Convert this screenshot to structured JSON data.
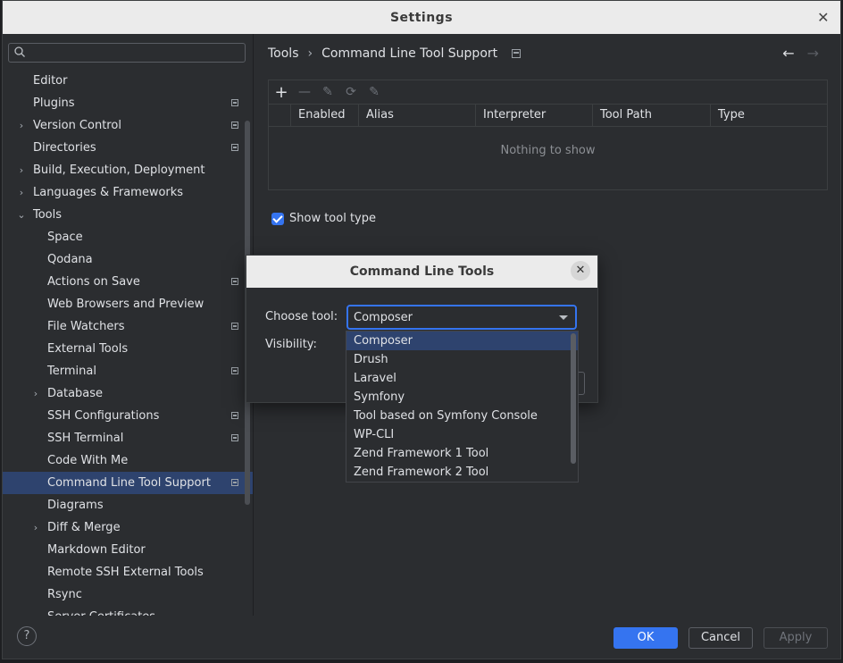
{
  "window": {
    "title": "Settings"
  },
  "sidebar": {
    "search_placeholder": "",
    "items": [
      {
        "label": "Editor",
        "level": 0,
        "expand": "none",
        "proj": false
      },
      {
        "label": "Plugins",
        "level": 0,
        "expand": "none",
        "proj": true
      },
      {
        "label": "Version Control",
        "level": 0,
        "expand": "collapsed",
        "proj": true
      },
      {
        "label": "Directories",
        "level": 0,
        "expand": "none",
        "proj": true
      },
      {
        "label": "Build, Execution, Deployment",
        "level": 0,
        "expand": "collapsed",
        "proj": false
      },
      {
        "label": "Languages & Frameworks",
        "level": 0,
        "expand": "collapsed",
        "proj": false
      },
      {
        "label": "Tools",
        "level": 0,
        "expand": "expanded",
        "proj": false
      },
      {
        "label": "Space",
        "level": 1,
        "expand": "none",
        "proj": false
      },
      {
        "label": "Qodana",
        "level": 1,
        "expand": "none",
        "proj": false
      },
      {
        "label": "Actions on Save",
        "level": 1,
        "expand": "none",
        "proj": true
      },
      {
        "label": "Web Browsers and Preview",
        "level": 1,
        "expand": "none",
        "proj": false
      },
      {
        "label": "File Watchers",
        "level": 1,
        "expand": "none",
        "proj": true
      },
      {
        "label": "External Tools",
        "level": 1,
        "expand": "none",
        "proj": false
      },
      {
        "label": "Terminal",
        "level": 1,
        "expand": "none",
        "proj": true
      },
      {
        "label": "Database",
        "level": 1,
        "expand": "collapsed",
        "proj": false
      },
      {
        "label": "SSH Configurations",
        "level": 1,
        "expand": "none",
        "proj": true
      },
      {
        "label": "SSH Terminal",
        "level": 1,
        "expand": "none",
        "proj": true
      },
      {
        "label": "Code With Me",
        "level": 1,
        "expand": "none",
        "proj": false
      },
      {
        "label": "Command Line Tool Support",
        "level": 1,
        "expand": "none",
        "proj": true,
        "selected": true
      },
      {
        "label": "Diagrams",
        "level": 1,
        "expand": "none",
        "proj": false
      },
      {
        "label": "Diff & Merge",
        "level": 1,
        "expand": "collapsed",
        "proj": false
      },
      {
        "label": "Markdown Editor",
        "level": 1,
        "expand": "none",
        "proj": false
      },
      {
        "label": "Remote SSH External Tools",
        "level": 1,
        "expand": "none",
        "proj": false
      },
      {
        "label": "Rsync",
        "level": 1,
        "expand": "none",
        "proj": false
      },
      {
        "label": "Server Certificates",
        "level": 1,
        "expand": "none",
        "proj": false
      }
    ]
  },
  "breadcrumb": {
    "parent": "Tools",
    "separator": "›",
    "current": "Command Line Tool Support"
  },
  "table": {
    "columns": [
      "Enabled",
      "Alias",
      "Interpreter",
      "Tool Path",
      "Type"
    ],
    "empty_text": "Nothing to show"
  },
  "show_tool_type": {
    "label": "Show tool type",
    "checked": true
  },
  "buttons": {
    "ok": "OK",
    "cancel": "Cancel",
    "apply": "Apply",
    "help": "?"
  },
  "dialog": {
    "title": "Command Line Tools",
    "choose_tool_label": "Choose tool:",
    "visibility_label": "Visibility:",
    "selected_tool": "Composer",
    "options": [
      "Composer",
      "Drush",
      "Laravel",
      "Symfony",
      "Tool based on Symfony Console",
      "WP-CLI",
      "Zend Framework 1 Tool",
      "Zend Framework 2 Tool"
    ]
  },
  "colors": {
    "accent": "#3574f0",
    "selection": "#2e436e",
    "background": "#2b2d30"
  }
}
